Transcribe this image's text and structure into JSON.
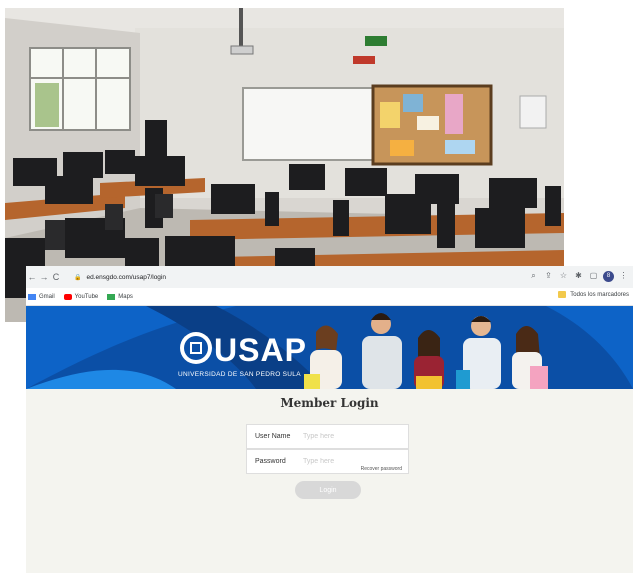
{
  "browser": {
    "url": "ed.ensgdo.com/usap7/login",
    "nav": {
      "back_icon": "←",
      "forward_icon": "→",
      "reload_icon": "C",
      "lock_icon": "🔒"
    },
    "toolbar_icons": [
      "zoom-icon",
      "share-icon",
      "star-icon",
      "extension-icon",
      "sidepanel-icon",
      "profile-icon",
      "menu-icon"
    ],
    "profile_initial": "8"
  },
  "bookmarks": {
    "items": [
      {
        "label": "Gmail",
        "icon": "gmail-icon",
        "color": "#4285f4"
      },
      {
        "label": "YouTube",
        "icon": "youtube-icon",
        "color": "#ff0000"
      },
      {
        "label": "Maps",
        "icon": "maps-icon",
        "color": "#34a853"
      }
    ],
    "all_bookmarks": "Todos los marcadores"
  },
  "banner": {
    "logo": "USAP",
    "subtitle": "UNIVERSIDAD DE SAN PEDRO SULA",
    "color": "#0b4fa6"
  },
  "login": {
    "title": "Member Login",
    "username_label": "User Name",
    "username_placeholder": "Type here",
    "password_label": "Password",
    "password_placeholder": "Type here",
    "password_hint": "Recover password",
    "button": "Login"
  }
}
